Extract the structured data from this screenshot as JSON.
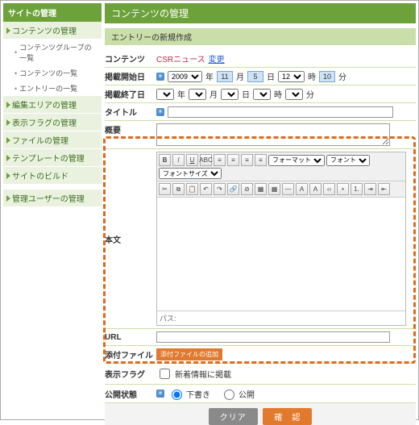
{
  "sidebar": {
    "title": "サイトの管理",
    "groups": [
      {
        "label": "コンテンツの管理",
        "children": [
          "コンテンツグループの一覧",
          "コンテンツの一覧",
          "エントリーの一覧"
        ]
      },
      {
        "label": "編集エリアの管理"
      },
      {
        "label": "表示フラグの管理"
      },
      {
        "label": "ファイルの管理"
      },
      {
        "label": "テンプレートの管理"
      },
      {
        "label": "サイトのビルド"
      }
    ],
    "group2_title": "管理ユーザーの管理"
  },
  "page": {
    "title": "コンテンツの管理",
    "panel": "エントリーの新規作成"
  },
  "form": {
    "contents_label": "コンテンツ",
    "contents_value": "CSRニュース",
    "contents_change": "変更",
    "pub_start_label": "掲載開始日",
    "pub_end_label": "掲載終了日",
    "date": {
      "year": "2009",
      "yu": "年",
      "month": "11",
      "mu": "月",
      "day": "5",
      "du": "日",
      "hour": "12",
      "hu": "時",
      "min": "10",
      "miu": "分"
    },
    "title_label": "タイトル",
    "summary_label": "概要",
    "body_label": "本文",
    "path_label": "パス:",
    "url_label": "URL",
    "attach_label": "添付ファイル",
    "attach_btn": "添付ファイルの追加",
    "flag_label": "表示フラグ",
    "flag_new": "新着情報に掲載",
    "pubstate_label": "公開状態",
    "pubstate_draft": "下書き",
    "pubstate_pub": "公開",
    "btn_clear": "クリア",
    "btn_confirm": "確　認"
  },
  "editor": {
    "formats": "フォーマット",
    "fonts": "フォント",
    "sizes": "フォントサイズ"
  }
}
